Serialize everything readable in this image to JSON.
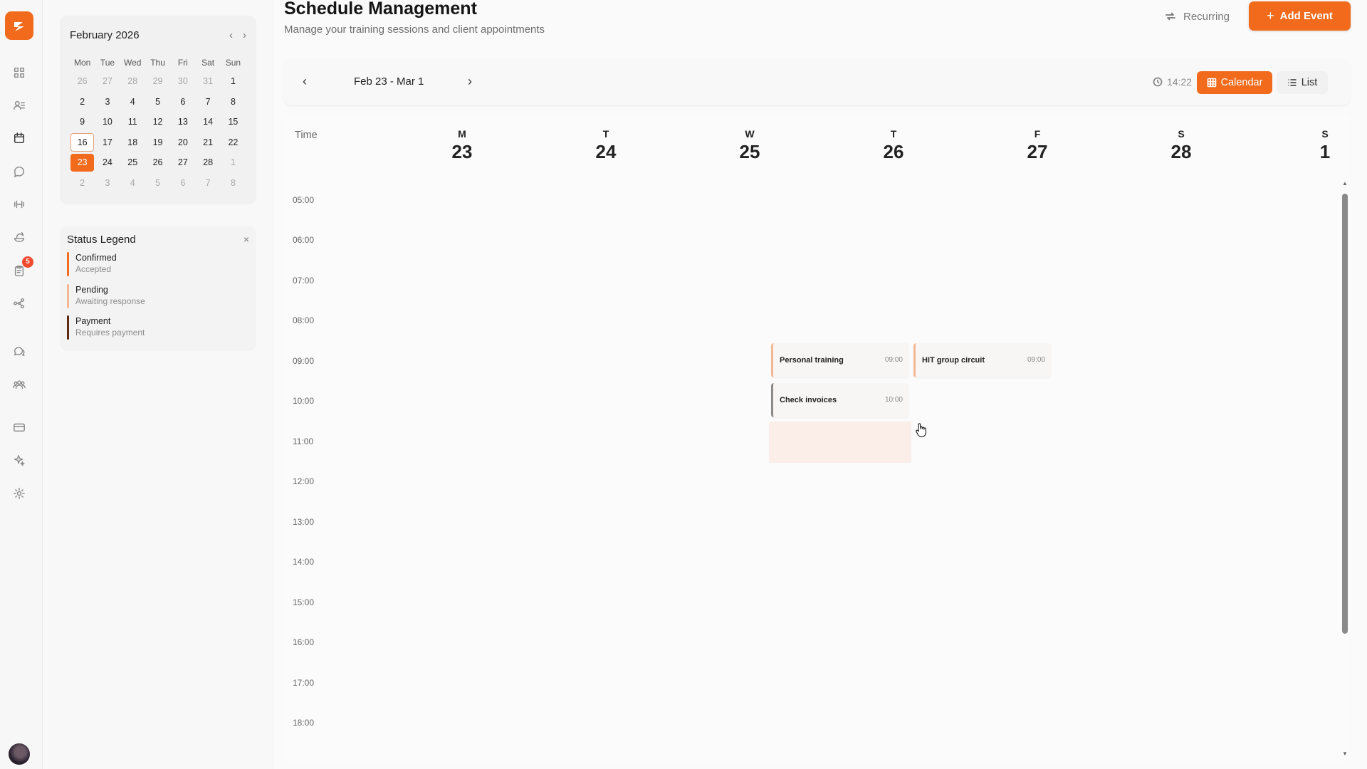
{
  "rail": {
    "icons": [
      "logo-icon",
      "dashboard-icon",
      "clients-icon",
      "calendar-icon",
      "messages-icon",
      "workouts-icon",
      "nutrition-icon",
      "tasks-icon",
      "workflow-icon",
      "chat-icon",
      "community-icon",
      "billing-icon",
      "ai-icon",
      "settings-icon"
    ],
    "tasks_badge": "5"
  },
  "mini_calendar": {
    "title": "February 2026",
    "weekdays": [
      "Mon",
      "Tue",
      "Wed",
      "Thu",
      "Fri",
      "Sat",
      "Sun"
    ],
    "weeks": [
      [
        "26",
        "27",
        "28",
        "29",
        "30",
        "31",
        "1"
      ],
      [
        "2",
        "3",
        "4",
        "5",
        "6",
        "7",
        "8"
      ],
      [
        "9",
        "10",
        "11",
        "12",
        "13",
        "14",
        "15"
      ],
      [
        "16",
        "17",
        "18",
        "19",
        "20",
        "21",
        "22"
      ],
      [
        "23",
        "24",
        "25",
        "26",
        "27",
        "28",
        "1"
      ],
      [
        "2",
        "3",
        "4",
        "5",
        "6",
        "7",
        "8"
      ]
    ],
    "today": "16",
    "selected": "23"
  },
  "legend": {
    "title": "Status Legend",
    "close": "×",
    "items": [
      {
        "name": "Confirmed",
        "desc": "Accepted",
        "color": "#f26a1b"
      },
      {
        "name": "Pending",
        "desc": "Awaiting response",
        "color": "#f3b892"
      },
      {
        "name": "Payment",
        "desc": "Requires payment",
        "color": "#5a2a12"
      }
    ]
  },
  "header": {
    "title": "Schedule Management",
    "subtitle": "Manage your training sessions and client appointments",
    "recurring": "Recurring",
    "add_event": "Add Event"
  },
  "toolbar": {
    "range": "Feb 23 - Mar 1",
    "time": "14:22",
    "view_calendar": "Calendar",
    "view_list": "List"
  },
  "week": {
    "time_header": "Time",
    "days": [
      {
        "letter": "M",
        "num": "23"
      },
      {
        "letter": "T",
        "num": "24"
      },
      {
        "letter": "W",
        "num": "25"
      },
      {
        "letter": "T",
        "num": "26"
      },
      {
        "letter": "F",
        "num": "27"
      },
      {
        "letter": "S",
        "num": "28"
      },
      {
        "letter": "S",
        "num": "1"
      }
    ],
    "hours": [
      "05:00",
      "06:00",
      "07:00",
      "08:00",
      "09:00",
      "10:00",
      "11:00",
      "12:00",
      "13:00",
      "14:00",
      "15:00",
      "16:00",
      "17:00",
      "18:00"
    ],
    "events": [
      {
        "title": "Personal training",
        "time": "09:00",
        "day": "26",
        "color": "#f3b892"
      },
      {
        "title": "HIT group circuit",
        "time": "09:00",
        "day": "27",
        "color": "#f3b892"
      },
      {
        "title": "Check invoices",
        "time": "10:00",
        "day": "26",
        "color": "#8a8a8a"
      }
    ]
  },
  "colors": {
    "accent": "#f26a1b"
  }
}
